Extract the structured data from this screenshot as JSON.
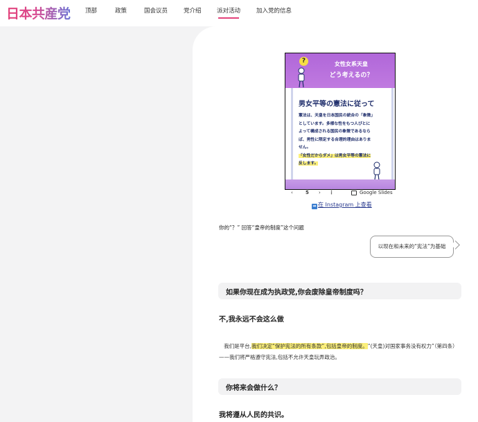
{
  "header": {
    "logo": "日本共産党",
    "nav": [
      {
        "label": "顶部",
        "active": false
      },
      {
        "label": "政策",
        "active": false
      },
      {
        "label": "国会议员",
        "active": false
      },
      {
        "label": "党介绍",
        "active": false
      },
      {
        "label": "派对活动",
        "active": true
      },
      {
        "label": "加入党的信息",
        "active": false
      }
    ],
    "accent_color": "#e3427a"
  },
  "slide": {
    "question_mark": "?",
    "title_line1": "女性女系天皇",
    "title_line2": "どう考えるの？",
    "heading": "男女平等の憲法に従って",
    "body_line1": "憲法は、天皇を日本国民の統合の「象徴」",
    "body_line2": "としています。多様な性をもつ人びとに",
    "body_line3": "よって構成される国民の象徴であるなら",
    "body_line4": "ば、男性に限定する合理的理由はありま",
    "body_line5": "せん。",
    "highlight_line1": "「女性だからダメ」は男女平等の憲法に",
    "highlight_line2": "反します。"
  },
  "controls": {
    "prev": "‹",
    "page": "5",
    "next": "›",
    "more": "⋮",
    "brand": "Google Slides"
  },
  "instagram": {
    "icon": "➡",
    "link_text": "在 Instagram 上查看"
  },
  "content": {
    "q_intro": "你的“？” 回答“皇帝的制度”这个问题",
    "bubble": "以现在和未来的“宪法”为基础",
    "q1": "如果你现在成为执政党,你会废除皇帝制度吗？",
    "a1": "不,我永远不会这么做",
    "para_prefix": "我们是平台,",
    "para_highlight": "我们决定“保护宪法的所有条款”,包括皇帝的制度。",
    "para_suffix": "“(天皇)对国家事务没有权力”（第四条）——我们将严格遵守宪法,包括不允许天皇玩弄政治。",
    "q2": "你将来会做什么？",
    "a2": "我将遵从人民的共识。"
  }
}
